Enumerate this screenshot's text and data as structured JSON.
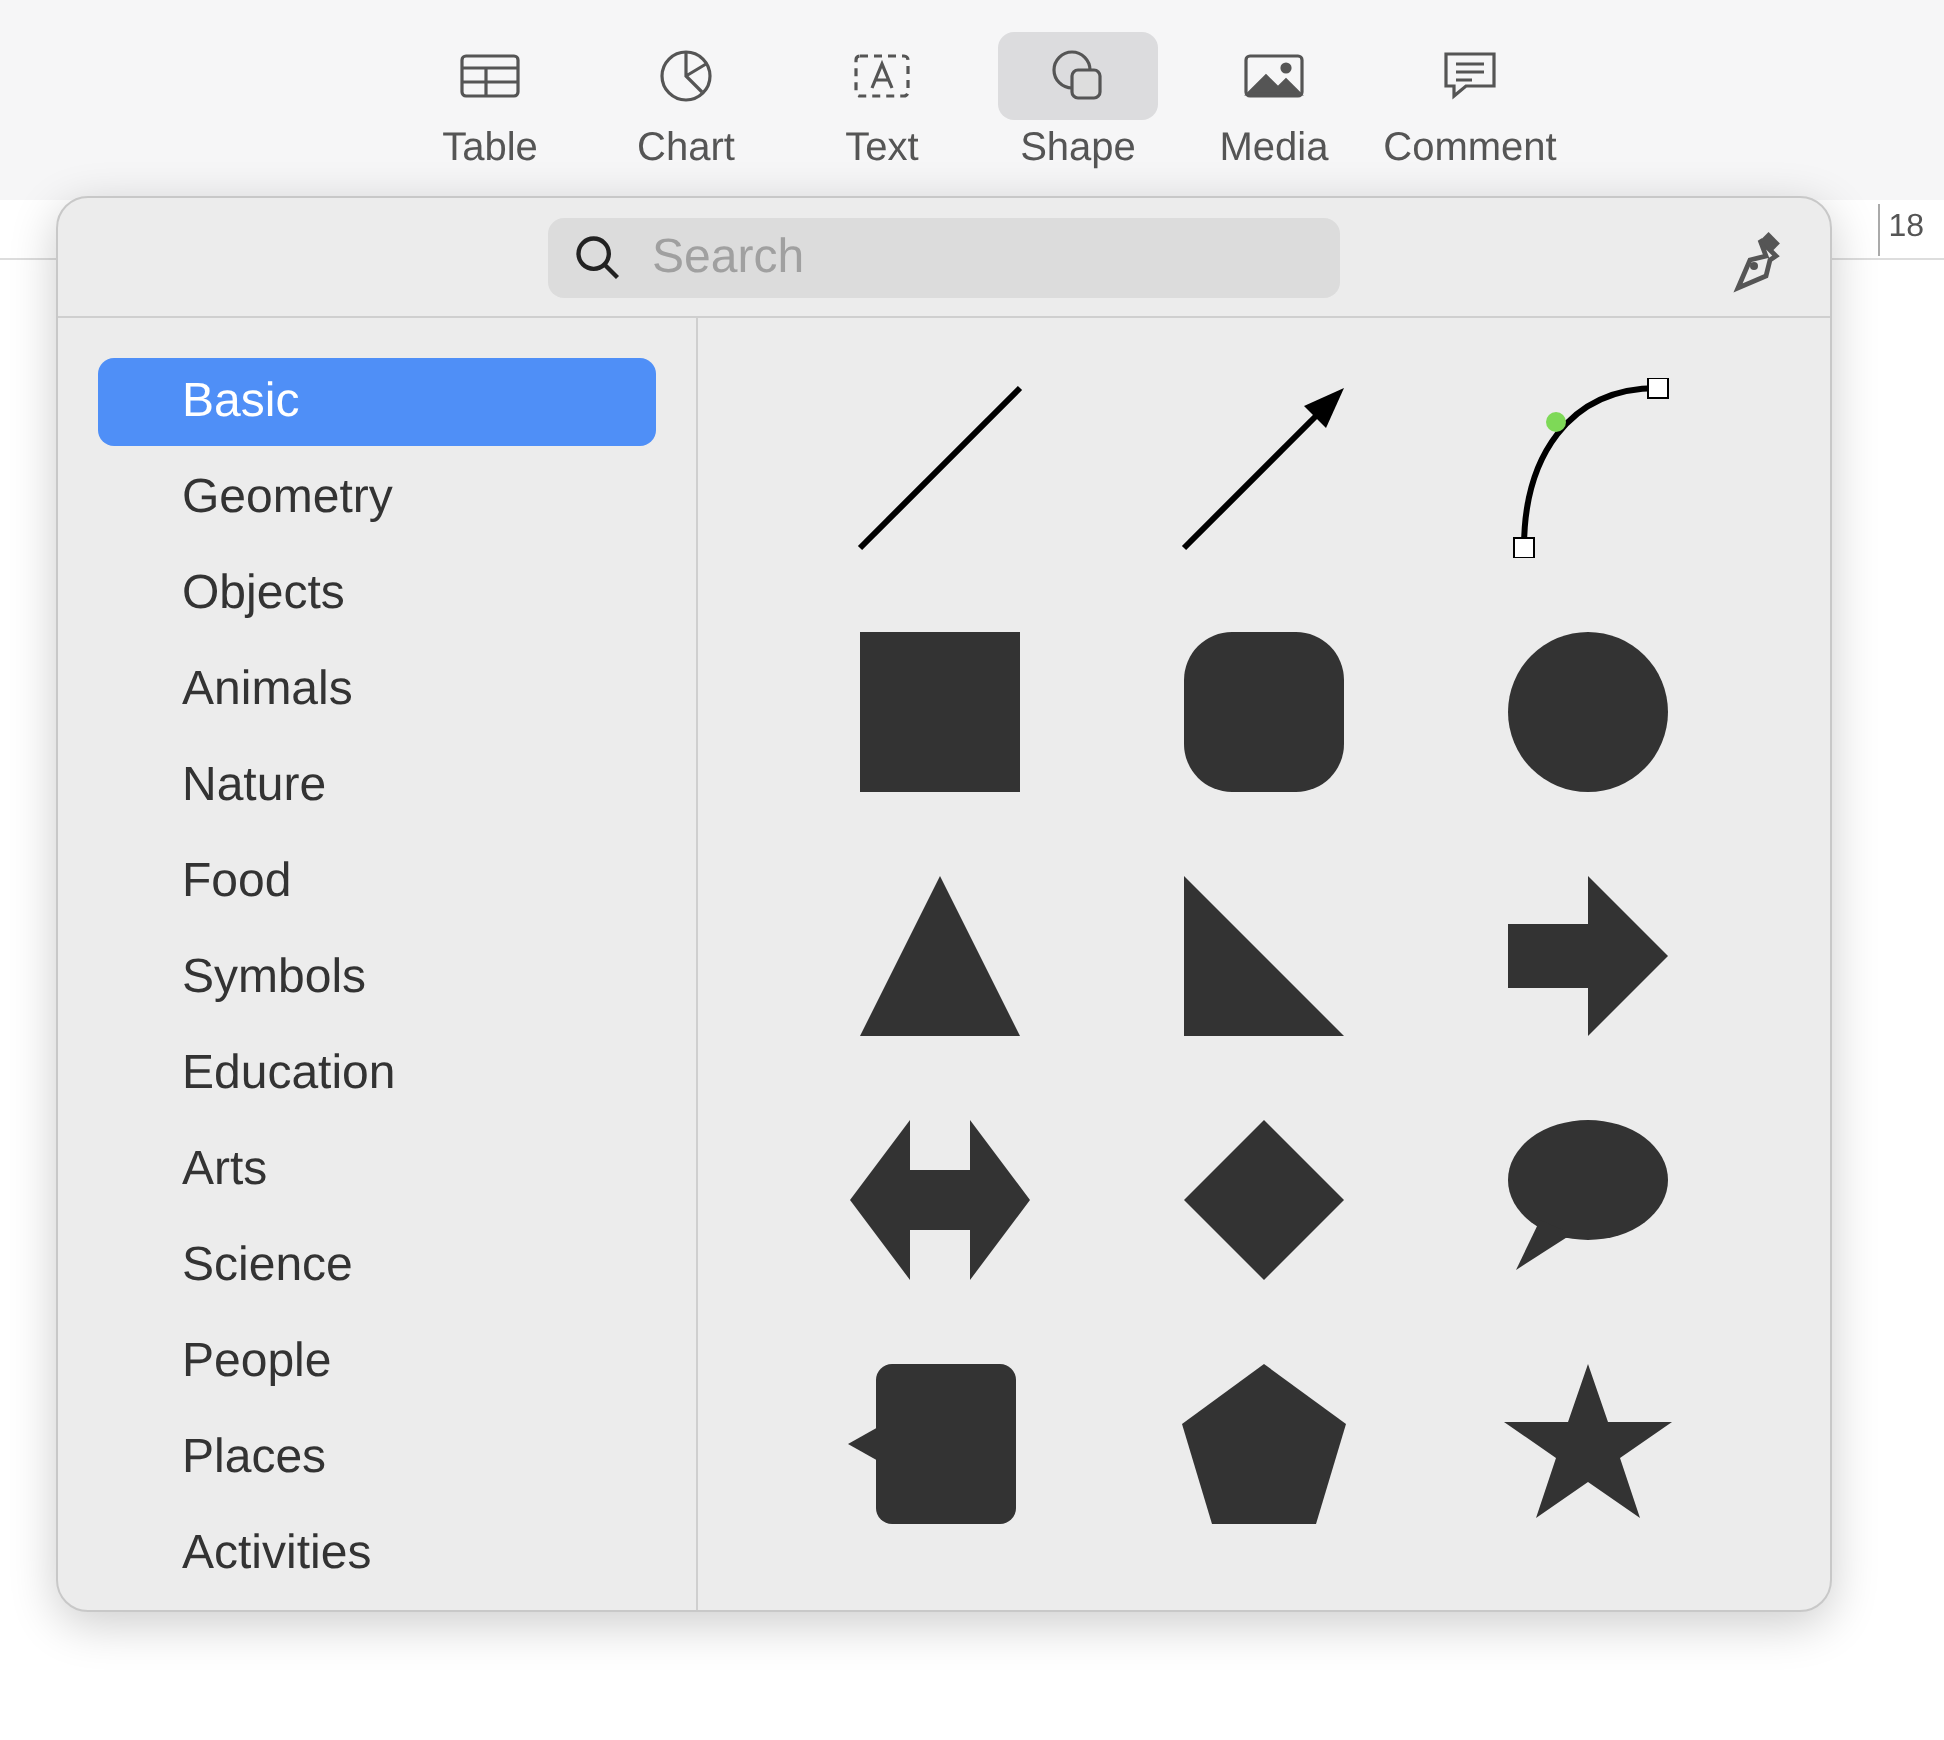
{
  "toolbar": {
    "buttons": [
      {
        "label": "Table",
        "selected": false
      },
      {
        "label": "Chart",
        "selected": false
      },
      {
        "label": "Text",
        "selected": false
      },
      {
        "label": "Shape",
        "selected": true
      },
      {
        "label": "Media",
        "selected": false
      },
      {
        "label": "Comment",
        "selected": false
      }
    ]
  },
  "ruler": {
    "mark": "18"
  },
  "shape_popover": {
    "search": {
      "placeholder": "Search"
    },
    "categories": [
      {
        "label": "Basic",
        "selected": true
      },
      {
        "label": "Geometry",
        "selected": false
      },
      {
        "label": "Objects",
        "selected": false
      },
      {
        "label": "Animals",
        "selected": false
      },
      {
        "label": "Nature",
        "selected": false
      },
      {
        "label": "Food",
        "selected": false
      },
      {
        "label": "Symbols",
        "selected": false
      },
      {
        "label": "Education",
        "selected": false
      },
      {
        "label": "Arts",
        "selected": false
      },
      {
        "label": "Science",
        "selected": false
      },
      {
        "label": "People",
        "selected": false
      },
      {
        "label": "Places",
        "selected": false
      },
      {
        "label": "Activities",
        "selected": false
      }
    ]
  }
}
